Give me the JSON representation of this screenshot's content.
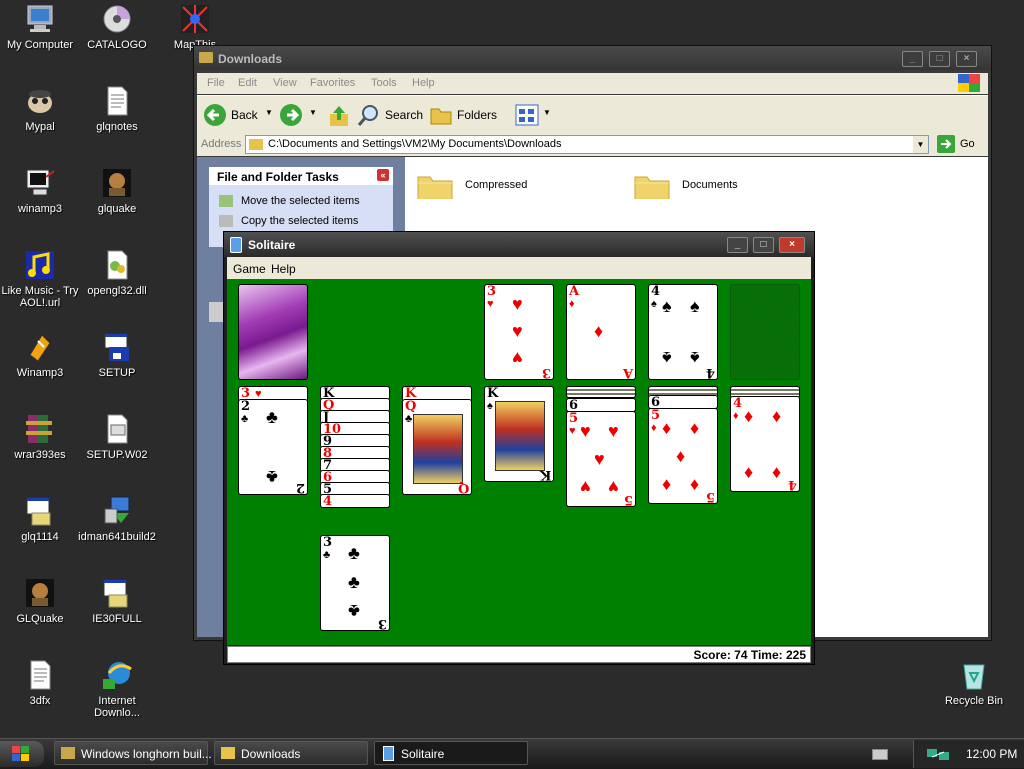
{
  "desktop": {
    "icons": [
      {
        "label": "My Computer"
      },
      {
        "label": "CATALOGO"
      },
      {
        "label": "MapThis"
      },
      {
        "label": "Mypal"
      },
      {
        "label": "glqnotes"
      },
      {
        "label": "winamp3"
      },
      {
        "label": "glquake"
      },
      {
        "label": "Like Music - Try AOL!.url"
      },
      {
        "label": "opengl32.dll"
      },
      {
        "label": "Winamp3"
      },
      {
        "label": "SETUP"
      },
      {
        "label": "wrar393es"
      },
      {
        "label": "SETUP.W02"
      },
      {
        "label": "glq1114"
      },
      {
        "label": "idman641build2"
      },
      {
        "label": "GLQuake"
      },
      {
        "label": "IE30FULL"
      },
      {
        "label": "3dfx"
      },
      {
        "label": "Internet Downlo..."
      },
      {
        "label": "Recycle Bin"
      }
    ]
  },
  "explorer": {
    "title": "Downloads",
    "menu": [
      "File",
      "Edit",
      "View",
      "Favorites",
      "Tools",
      "Help"
    ],
    "toolbar": {
      "back": "Back",
      "search": "Search",
      "folders": "Folders"
    },
    "address": {
      "label": "Address",
      "value": "C:\\Documents and Settings\\VM2\\My Documents\\Downloads",
      "go": "Go"
    },
    "tasks": {
      "header": "File and Folder Tasks",
      "items": [
        "Move the selected items",
        "Copy the selected items"
      ]
    },
    "folders": [
      "Compressed",
      "Documents"
    ]
  },
  "solitaire": {
    "title": "Solitaire",
    "menu": [
      "Game",
      "Help"
    ],
    "status": "Score: 74 Time: 225"
  },
  "taskbar": {
    "buttons": [
      "Windows longhorn buil...",
      "Downloads",
      "Solitaire"
    ],
    "clock": "12:00 PM"
  },
  "colors": {
    "felt": "#008000",
    "card_red": "#e00000"
  }
}
